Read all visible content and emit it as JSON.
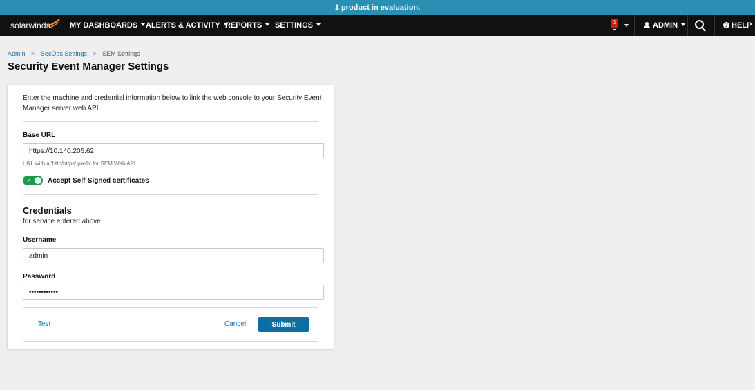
{
  "banner": {
    "text": "1 product in evaluation."
  },
  "nav": {
    "logo_text": "solarwinds",
    "items": [
      {
        "label": "MY DASHBOARDS"
      },
      {
        "label": "ALERTS & ACTIVITY"
      },
      {
        "label": "REPORTS"
      },
      {
        "label": "SETTINGS"
      }
    ],
    "alert_count": "3",
    "user_label": "ADMIN",
    "help_label": "HELP",
    "help_glyph": "?"
  },
  "breadcrumb": {
    "items": [
      "Admin",
      "SecObs Settings",
      "SEM Settings"
    ],
    "separator": ">"
  },
  "page": {
    "title": "Security Event Manager Settings"
  },
  "form": {
    "intro": "Enter the machine and credential information below to link the web console to your Security Event Manager server web API.",
    "base_url_label": "Base URL",
    "base_url_value": "https://10.140.205.62",
    "base_url_hint": "URL with a 'http/https' prefix for SEM Web API",
    "accept_cert_label": "Accept Self-Signed certificates",
    "accept_cert_enabled": true,
    "credentials_title": "Credentials",
    "credentials_subtitle": "for service entered above",
    "username_label": "Username",
    "username_value": "admin",
    "password_label": "Password",
    "password_value": "••••••••••••",
    "test_label": "Test",
    "cancel_label": "Cancel",
    "submit_label": "Submit"
  },
  "colors": {
    "banner_bg": "#2b8fb3",
    "nav_bg": "#111111",
    "accent": "#0d6ea3",
    "toggle_on": "#1c9c4b",
    "alert_badge": "#d41a1a"
  },
  "icons": {
    "logo": "solarwinds-logo-icon",
    "user": "person-icon",
    "search": "search-icon",
    "help": "help-icon",
    "toggle_check": "check-icon"
  }
}
